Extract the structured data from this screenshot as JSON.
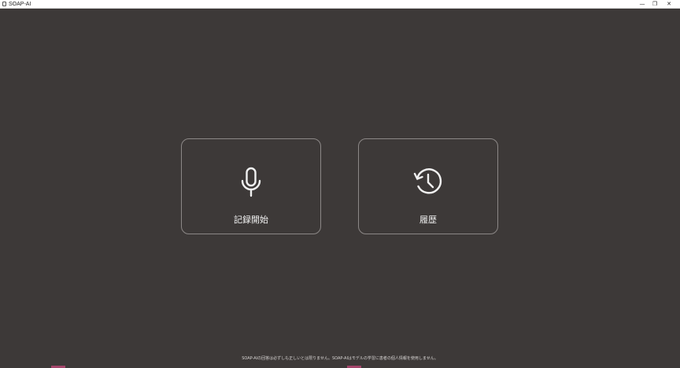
{
  "window": {
    "title": "SOAP-AI",
    "controls": {
      "minimize": "—",
      "maximize": "❐",
      "close": "✕"
    }
  },
  "main": {
    "cards": [
      {
        "label": "記録開始",
        "icon": "microphone-icon"
      },
      {
        "label": "履歴",
        "icon": "history-icon"
      }
    ]
  },
  "footer": {
    "disclaimer": "SOAP-AIの回答は必ずしも正しいとは限りません。SOAP-AIはモデルの学習に患者の個人情報を使用しません。"
  },
  "colors": {
    "background": "#3d3938",
    "card_border": "#8c8887",
    "text": "#f1f1f1",
    "accent": "#a3456a"
  }
}
